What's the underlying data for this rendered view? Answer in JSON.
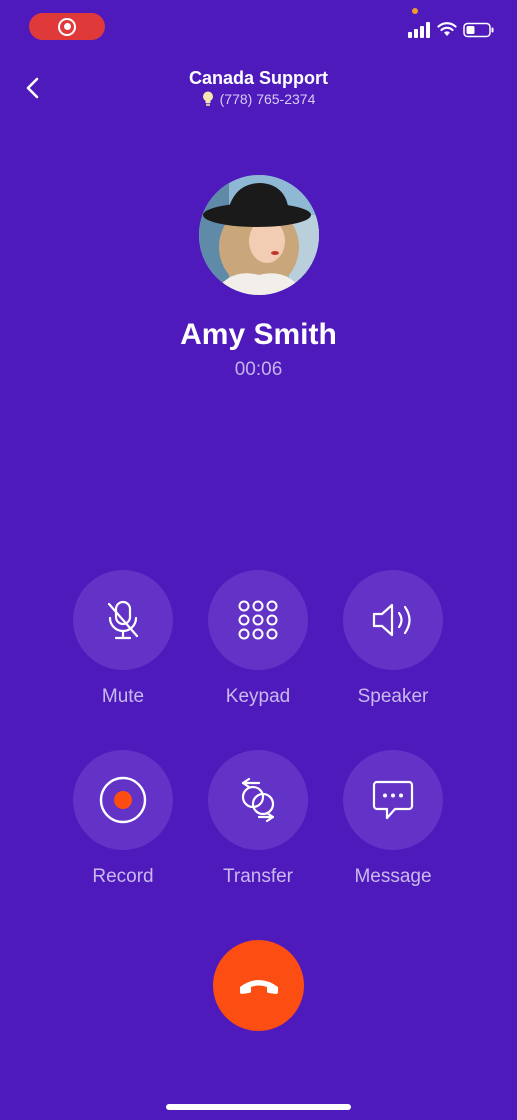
{
  "status_bar": {
    "recording_indicator": "record-icon",
    "signal": "cellular-signal-icon",
    "wifi": "wifi-icon",
    "battery": "battery-icon"
  },
  "header": {
    "back_icon": "chevron-left-icon",
    "title": "Canada Support",
    "phone_number": "(778) 765-2374",
    "number_icon": "lightbulb-icon"
  },
  "contact": {
    "name": "Amy Smith",
    "timer": "00:06"
  },
  "actions": [
    {
      "label": "Mute",
      "icon": "microphone-off-icon"
    },
    {
      "label": "Keypad",
      "icon": "keypad-icon"
    },
    {
      "label": "Speaker",
      "icon": "speaker-icon"
    },
    {
      "label": "Record",
      "icon": "record-icon"
    },
    {
      "label": "Transfer",
      "icon": "transfer-icon"
    },
    {
      "label": "Message",
      "icon": "message-icon"
    }
  ],
  "end_call": {
    "icon": "phone-hangup-icon"
  },
  "colors": {
    "background": "#4f1abb",
    "button_bg": "#6233c6",
    "end_call": "#fc4e12",
    "record_dot": "#fc4e12"
  }
}
